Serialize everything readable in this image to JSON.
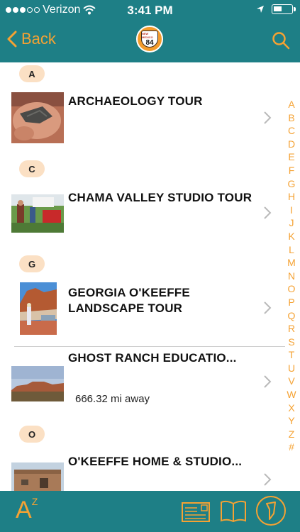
{
  "status": {
    "carrier": "Verizon",
    "time": "3:41 PM"
  },
  "nav": {
    "back_label": "Back",
    "logo_state": "NEW MEXICO",
    "logo_number": "84"
  },
  "sections": [
    {
      "letter": "A"
    },
    {
      "letter": "C"
    },
    {
      "letter": "G"
    },
    {
      "letter": "O"
    }
  ],
  "items": [
    {
      "title": "ARCHAEOLOGY TOUR",
      "distance": ""
    },
    {
      "title": "CHAMA VALLEY STUDIO TOUR",
      "distance": ""
    },
    {
      "title": "GEORGIA O'KEEFFE LANDSCAPE TOUR",
      "distance": ""
    },
    {
      "title": "GHOST RANCH EDUCATIO...",
      "distance": "666.32 mi away"
    },
    {
      "title": "O'KEEFFE HOME & STUDIO...",
      "distance": ""
    }
  ],
  "index_letters": [
    "A",
    "B",
    "C",
    "D",
    "E",
    "F",
    "G",
    "H",
    "I",
    "J",
    "K",
    "L",
    "M",
    "N",
    "O",
    "P",
    "Q",
    "R",
    "S",
    "T",
    "U",
    "V",
    "W",
    "X",
    "Y",
    "Z",
    "#"
  ],
  "bottom": {
    "az_main": "A",
    "az_sup": "Z"
  },
  "colors": {
    "teal": "#1e7f86",
    "accent": "#f5a233",
    "badge": "#fbe0c4"
  }
}
